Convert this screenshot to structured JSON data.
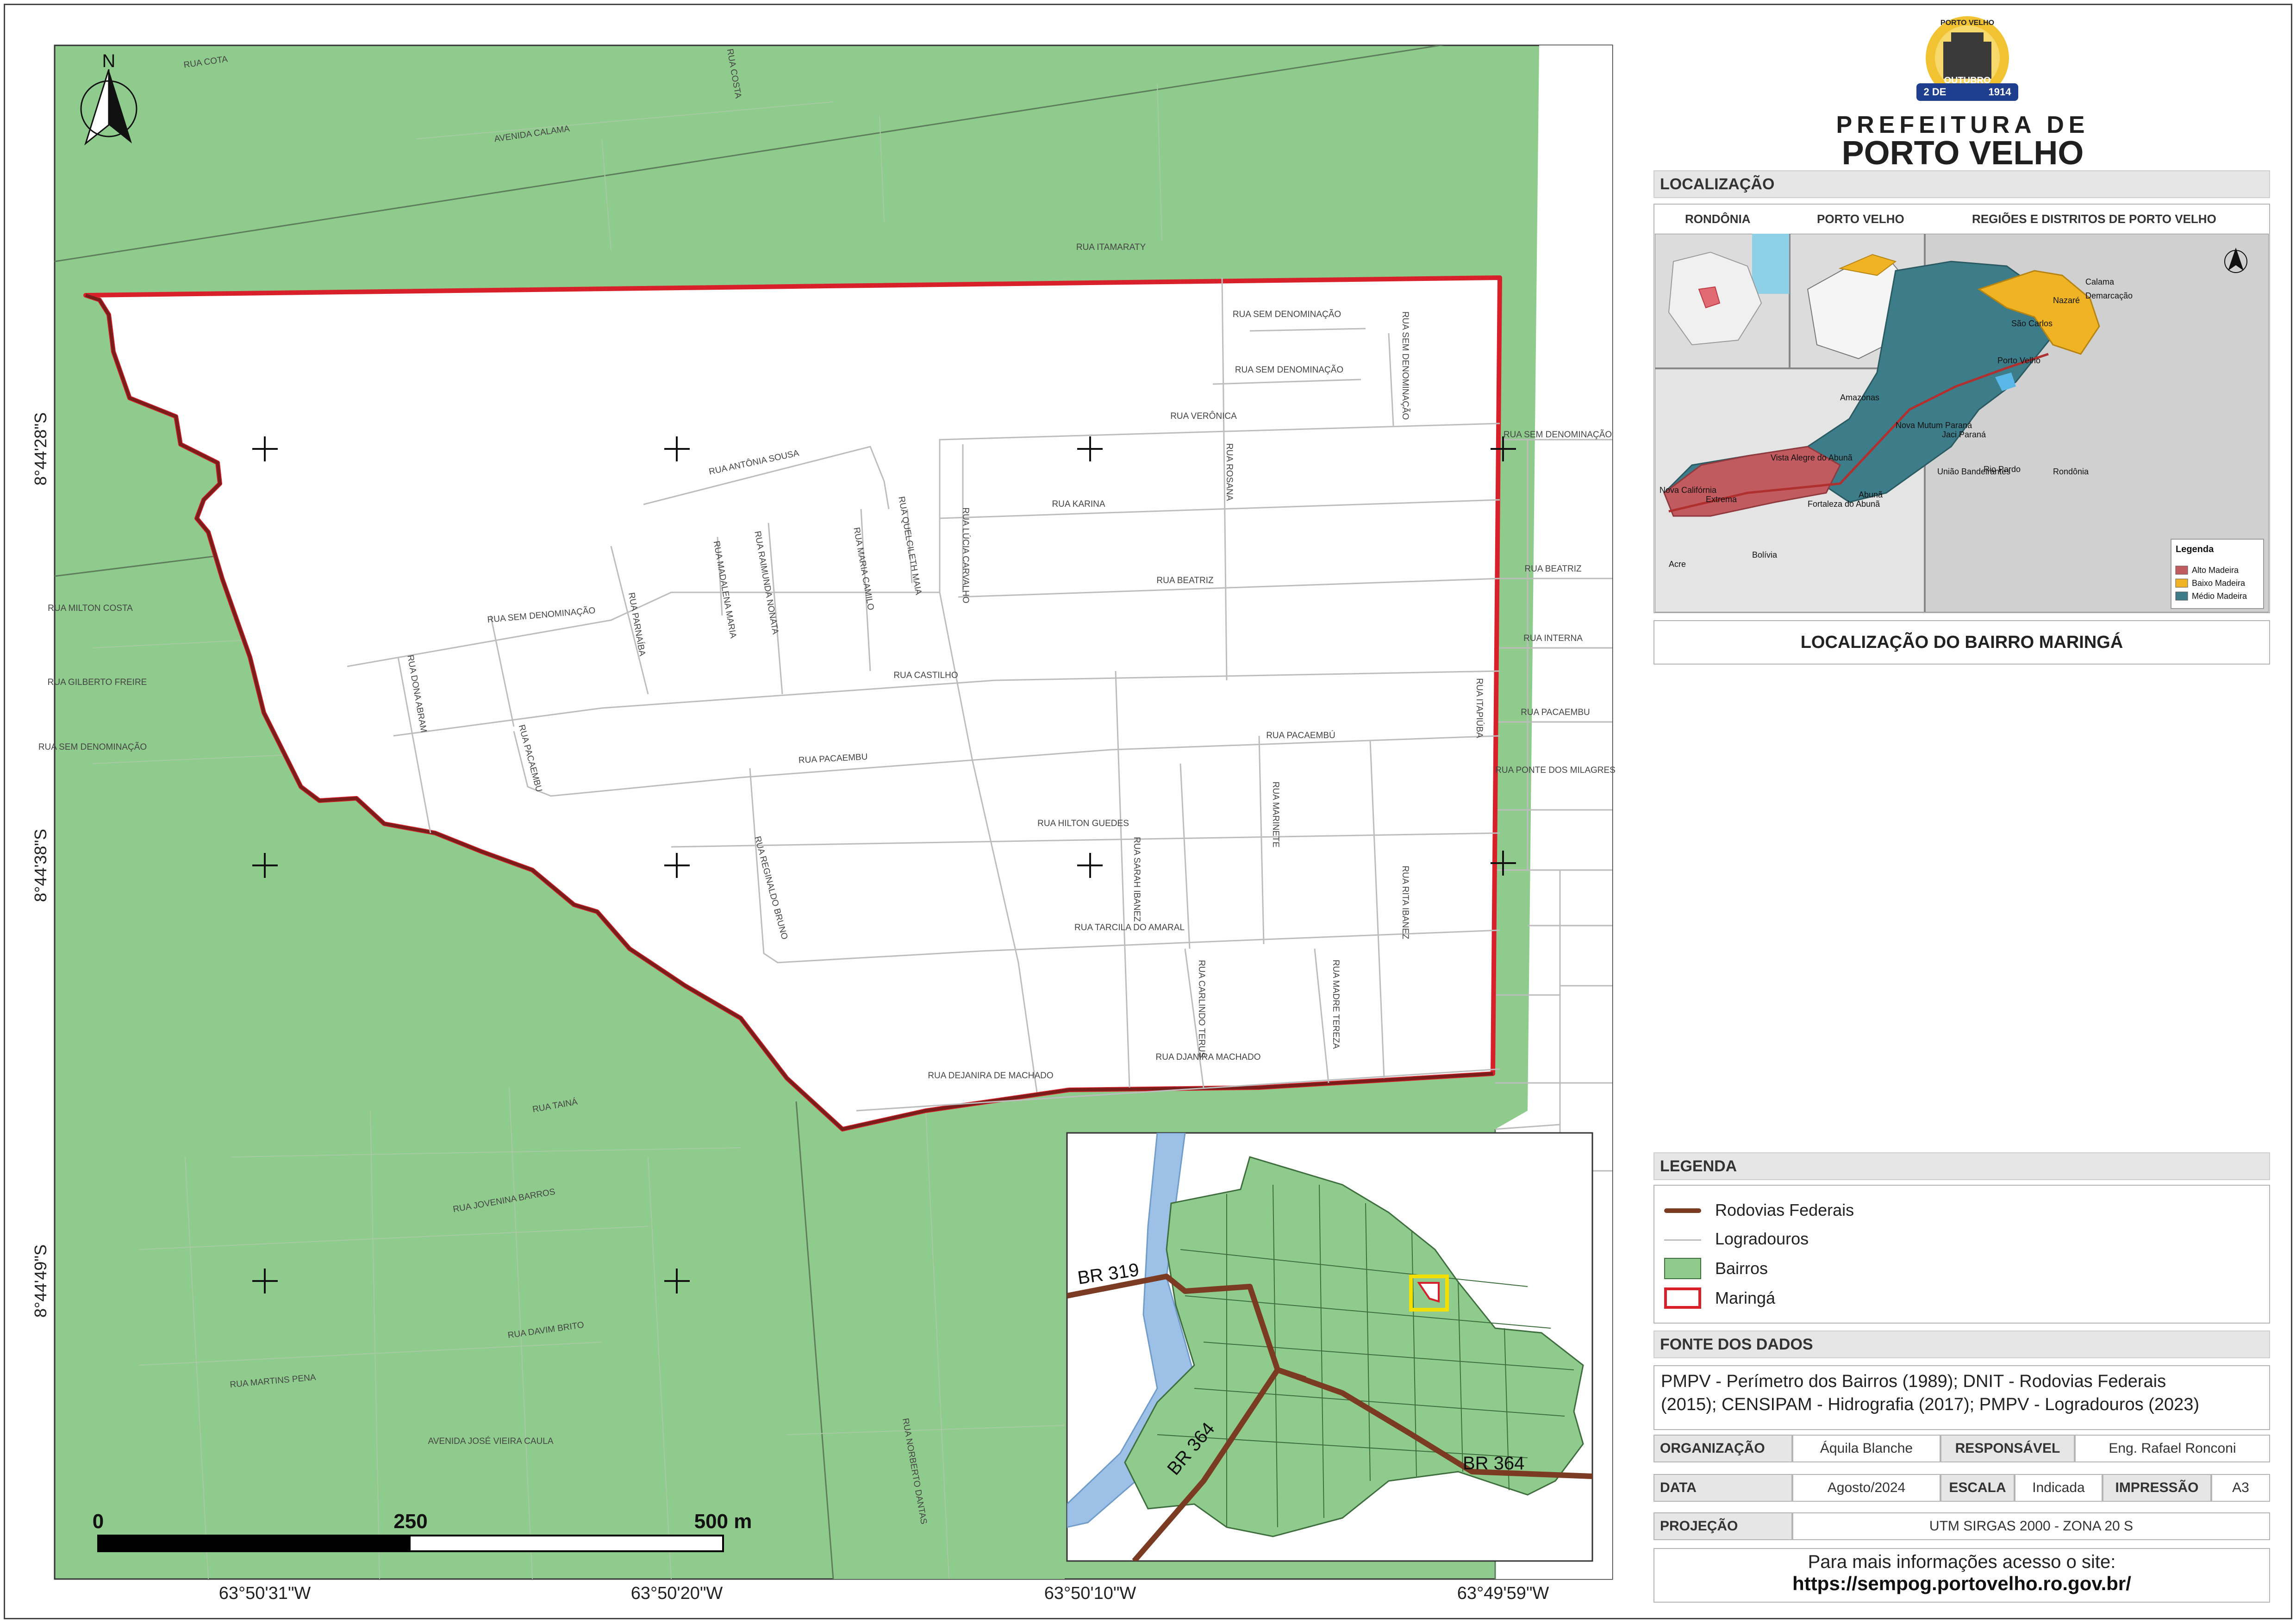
{
  "header": {
    "title_line1": "PREFEITURA DE",
    "title_line2": "PORTO VELHO",
    "seal_top": "PORTO VELHO",
    "seal_ribbon": "OUTUBRO",
    "seal_left": "2 DE",
    "seal_right": "1914"
  },
  "map": {
    "north_label": "N",
    "lat_labels": [
      "8°44'28\"S",
      "8°44'38\"S",
      "8°44'49\"S"
    ],
    "lon_labels": [
      "63°50'31\"W",
      "63°50'20\"W",
      "63°50'10\"W",
      "63°49'59\"W"
    ],
    "scale": {
      "start": "0",
      "mid": "250",
      "end": "500 m"
    },
    "colors": {
      "bairros": "#8fcb8c",
      "perimeter": "#d8202a",
      "road": "#7a3b22",
      "river": "#9cc0e6"
    },
    "streets_inside": [
      "RUA SEM DENOMINAÇÃO",
      "RUA SEM DENOMINAÇÃO",
      "RUA SEM DENOMINAÇÃO",
      "RUA VERÔNICA",
      "RUA ANTÔNIA SOUSA",
      "RUA KARINA",
      "RUA ROSANA",
      "RUA BEATRIZ",
      "RUA CASTILHO",
      "RUA PACAEMBU",
      "RUA PACAEMBÚ",
      "RUA HILTON GUEDES",
      "RUA TARCILA DO AMARAL",
      "RUA DJANIRA MACHADO",
      "RUA DEJANIRA DE MACHADO",
      "RUA LÚCIA CARVALHO",
      "RUA MARINETE",
      "RUA RITA IBANEZ",
      "RUA SARAH IBANEZ",
      "RUA MADRE TEREZA",
      "RUA CARLINDO TERUS",
      "RUA REGINALDO BRUNO",
      "RUA DONA ABRAM",
      "RUA PARNAÍBA",
      "RUA MARIA CAMILO",
      "RUA QUELCILETH MAIA",
      "RUA RAIMUNDA NONATA",
      "RUA MADALENA MARIA",
      "RUA PACAEMBU",
      "RUA SEM DENOMINAÇÃO"
    ],
    "streets_outside": [
      "RUA SEM DENOMINAÇÃO",
      "RUA BEATRIZ",
      "RUA INTERNA",
      "RUA PACAEMBU",
      "RUA PONTE DOS MILAGRES",
      "RUA ITAMARATY",
      "AVENIDA CALAMA",
      "RUA MILTON COSTA",
      "RUA GILBERTO FREIRE",
      "RUA SEM DENOMINAÇÃO",
      "RUA TAINÁ",
      "RUA JOVENINA BARROS",
      "RUA MARTINS PENA",
      "RUA DAVIM BRITO",
      "AVENIDA JOSÉ VIEIRA CAULA",
      "RUA NORBERTO DANTAS",
      "RUA COTA",
      "RUA COSTA",
      "RUA ITAPIÚBA"
    ],
    "inset": {
      "br319": "BR 319",
      "br364a": "BR 364",
      "br364b": "BR 364"
    }
  },
  "localizacao": {
    "header": "LOCALIZAÇÃO",
    "cols": [
      "RONDÔNIA",
      "PORTO VELHO",
      "REGIÕES E DISTRITOS DE PORTO VELHO"
    ],
    "places": [
      "Amazonas",
      "Acre",
      "Bolívia",
      "Rondônia",
      "Nova Califórnia",
      "Extrema",
      "Vista Alegre do Abunã",
      "Fortaleza do Abunã",
      "Abunã",
      "Nova Mutum Paraná",
      "Jaci Paraná",
      "União Bandeirantes",
      "Rio Pardo",
      "Porto Velho",
      "São Carlos",
      "Nazaré",
      "Calama",
      "Demarcação"
    ],
    "legend_title": "Legenda",
    "legend_items": [
      {
        "label": "Alto Madeira",
        "color": "#c25b60"
      },
      {
        "label": "Baixo Madeira",
        "color": "#f0b323"
      },
      {
        "label": "Médio Madeira",
        "color": "#3d7d8a"
      }
    ],
    "title": "LOCALIZAÇÃO DO BAIRRO MARINGÁ"
  },
  "legenda": {
    "header": "LEGENDA",
    "items": [
      "Rodovias Federais",
      "Logradouros",
      "Bairros",
      "Maringá"
    ]
  },
  "fonte": {
    "header": "FONTE DOS DADOS",
    "line1": "PMPV - Perímetro dos Bairros (1989); DNIT - Rodovias Federais",
    "line2": "(2015); CENSIPAM - Hidrografia (2017); PMPV - Logradouros (2023)"
  },
  "meta": {
    "organizacao_label": "ORGANIZAÇÃO",
    "organizacao": "Áquila Blanche",
    "responsavel_label": "RESPONSÁVEL",
    "responsavel": "Eng. Rafael Ronconi",
    "data_label": "DATA",
    "data": "Agosto/2024",
    "escala_label": "ESCALA",
    "escala": "Indicada",
    "impressao_label": "IMPRESSÃO",
    "impressao": "A3",
    "projecao_label": "PROJEÇÃO",
    "projecao": "UTM SIRGAS 2000 - ZONA 20 S"
  },
  "footer": {
    "line1": "Para mais informações acesso o site:",
    "url": "https://sempog.portovelho.ro.gov.br/"
  }
}
